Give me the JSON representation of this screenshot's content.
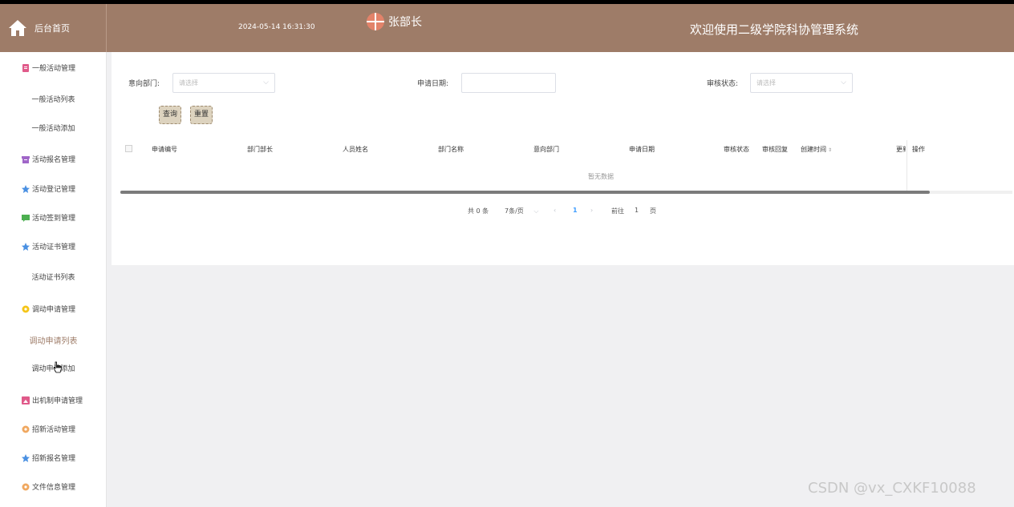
{
  "header": {
    "home_label": "后台首页",
    "datetime": "2024-05-14 16:31:30",
    "user_name": "张部长",
    "system_title": "欢迎使用二级学院科协管理系统",
    "bg_color": "#9e7c68"
  },
  "sidebar": {
    "items": [
      {
        "label": "一般活动管理",
        "icon": "document-icon",
        "color": "#e05a8a"
      },
      {
        "label": "一般活动列表"
      },
      {
        "label": "一般活动添加"
      },
      {
        "label": "活动报名管理",
        "icon": "archive-icon",
        "color": "#a066c8"
      },
      {
        "label": "活动登记管理",
        "icon": "star-icon",
        "color": "#4a90e2"
      },
      {
        "label": "活动签到管理",
        "icon": "comment-icon",
        "color": "#4caf50"
      },
      {
        "label": "活动证书管理",
        "icon": "star-icon",
        "color": "#4a90e2"
      },
      {
        "label": "活动证书列表"
      },
      {
        "label": "调动申请管理",
        "icon": "flower-icon",
        "color": "#f5c518"
      },
      {
        "label": "调动申请列表"
      },
      {
        "label": "调动申请添加"
      },
      {
        "label": "出机制申请管理",
        "icon": "image-icon",
        "color": "#e05a8a"
      },
      {
        "label": "招新活动管理",
        "icon": "flower-icon",
        "color": "#f0a860"
      },
      {
        "label": "招新报名管理",
        "icon": "star-icon",
        "color": "#4a90e2"
      },
      {
        "label": "文件信息管理",
        "icon": "flower-icon",
        "color": "#f0a860"
      }
    ]
  },
  "filters": {
    "dept_label": "意向部门:",
    "dept_placeholder": "请选择",
    "date_label": "申请日期:",
    "date_value": "",
    "status_label": "审核状态:",
    "status_placeholder": "请选择",
    "search_btn": "查询",
    "reset_btn": "重置"
  },
  "table": {
    "columns": [
      "申请编号",
      "部门部长",
      "人员姓名",
      "部门名称",
      "意向部门",
      "申请日期",
      "审核状态",
      "审核回复",
      "创建时间",
      "更新",
      "操作"
    ],
    "empty_text": "暂无数据"
  },
  "pagination": {
    "total": "共 0 条",
    "page_size": "7条/页",
    "current_page": "1",
    "goto_label": "前往",
    "goto_value": "1",
    "page_unit": "页"
  },
  "watermark": "CSDN @vx_CXKF10088"
}
